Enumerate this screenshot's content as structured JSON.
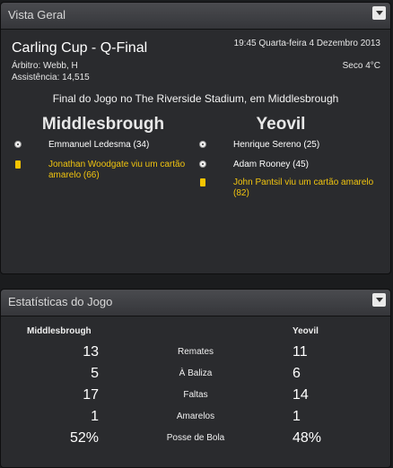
{
  "overview": {
    "title": "Vista Geral",
    "competition": "Carling Cup - Q-Final",
    "referee": "Árbitro: Webb, H",
    "attendance": "Assistência: 14,515",
    "datetime": "19:45 Quarta-feira 4 Dezembro 2013",
    "weather": "Seco 4°C",
    "final_line": "Final do Jogo no The Riverside Stadium, em Middlesbrough",
    "home_team": "Middlesbrough",
    "away_team": "Yeovil",
    "home_events": [
      {
        "type": "goal",
        "icon": "ball-icon",
        "text": "Emmanuel Ledesma (34)"
      },
      {
        "type": "card",
        "icon": "yellow-card-icon",
        "text": "Jonathan Woodgate viu um cartão amarelo (66)"
      }
    ],
    "away_events": [
      {
        "type": "goal",
        "icon": "ball-icon",
        "text": "Henrique Sereno (25)"
      },
      {
        "type": "goal",
        "icon": "ball-icon",
        "text": "Adam Rooney (45)"
      },
      {
        "type": "card",
        "icon": "yellow-card-icon",
        "text": "John Pantsil viu um cartão amarelo (82)"
      }
    ]
  },
  "stats": {
    "title": "Estatísticas do Jogo",
    "home_team": "Middlesbrough",
    "away_team": "Yeovil",
    "rows": [
      {
        "label": "Remates",
        "home": "13",
        "away": "11"
      },
      {
        "label": "À Baliza",
        "home": "5",
        "away": "6"
      },
      {
        "label": "Faltas",
        "home": "17",
        "away": "14"
      },
      {
        "label": "Amarelos",
        "home": "1",
        "away": "1"
      },
      {
        "label": "Posse de Bola",
        "home": "52%",
        "away": "48%"
      }
    ]
  },
  "colors": {
    "card_text": "#f1c40f",
    "panel_bg": "#2a2b2e",
    "header_bg": "#3f4044"
  }
}
